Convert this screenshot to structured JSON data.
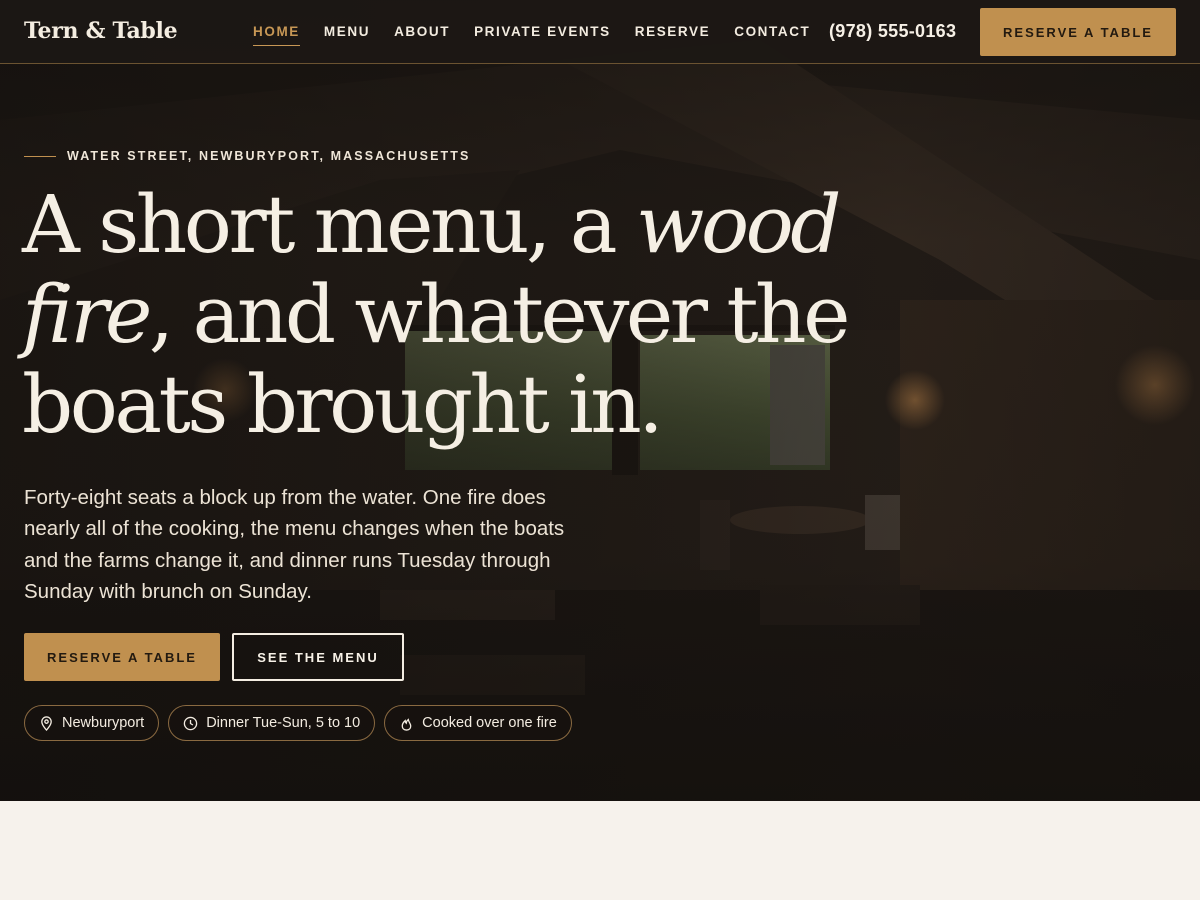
{
  "brand": {
    "name": "Tern & Table"
  },
  "nav": {
    "links": [
      {
        "label": "HOME",
        "active": true
      },
      {
        "label": "MENU",
        "active": false
      },
      {
        "label": "ABOUT",
        "active": false
      },
      {
        "label": "PRIVATE EVENTS",
        "active": false
      },
      {
        "label": "RESERVE",
        "active": false
      },
      {
        "label": "CONTACT",
        "active": false
      }
    ],
    "phone": "(978) 555-0163",
    "cta_label": "RESERVE A TABLE"
  },
  "hero": {
    "eyebrow": "WATER STREET, NEWBURYPORT, MASSACHUSETTS",
    "headline": {
      "part1": "A short menu, a ",
      "em1": "wood fire",
      "part2": ", and whatever the boats brought in."
    },
    "lede": "Forty-eight seats a block up from the water. One fire does nearly all of the cooking, the menu changes when the boats and the farms change it, and dinner runs Tuesday through Sunday with brunch on Sunday.",
    "primary_cta": "RESERVE A TABLE",
    "secondary_cta": "SEE THE MENU",
    "chips": [
      {
        "icon": "map-pin-icon",
        "label": "Newburyport"
      },
      {
        "icon": "clock-icon",
        "label": "Dinner Tue-Sun, 5 to 10"
      },
      {
        "icon": "flame-icon",
        "label": "Cooked over one fire"
      }
    ]
  },
  "colors": {
    "accent": "#c0904f",
    "nav_bg": "#1c1815",
    "hero_text": "#f5efe4",
    "page_bg": "#f6f2ec"
  }
}
